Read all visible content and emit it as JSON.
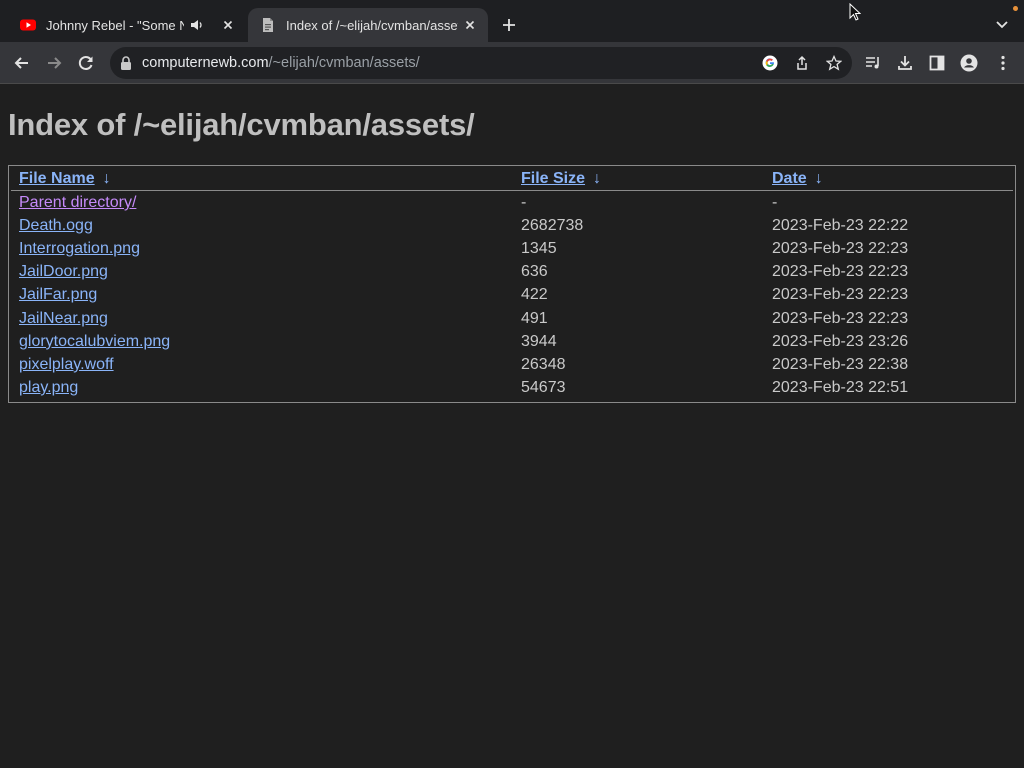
{
  "tabs": [
    {
      "title": "Johnny Rebel - \"Some N*\"",
      "icon": "youtube-icon",
      "audio": true,
      "active": false
    },
    {
      "title": "Index of /~elijah/cvmban/assets/",
      "icon": "document-favicon",
      "audio": false,
      "active": true
    }
  ],
  "address_bar": {
    "host": "computernewb.com",
    "path": "/~elijah/cvmban/assets/"
  },
  "page": {
    "heading": "Index of /~elijah/cvmban/assets/",
    "columns": {
      "name": "File Name",
      "size": "File Size",
      "date": "Date",
      "sort_arrow": "↓"
    },
    "rows": [
      {
        "name": "Parent directory/",
        "size": "-",
        "date": "-"
      },
      {
        "name": "Death.ogg",
        "size": "2682738",
        "date": "2023-Feb-23 22:22"
      },
      {
        "name": "Interrogation.png",
        "size": "1345",
        "date": "2023-Feb-23 22:23"
      },
      {
        "name": "JailDoor.png",
        "size": "636",
        "date": "2023-Feb-23 22:23"
      },
      {
        "name": "JailFar.png",
        "size": "422",
        "date": "2023-Feb-23 22:23"
      },
      {
        "name": "JailNear.png",
        "size": "491",
        "date": "2023-Feb-23 22:23"
      },
      {
        "name": "glorytocalubviem.png",
        "size": "3944",
        "date": "2023-Feb-23 23:26"
      },
      {
        "name": "pixelplay.woff",
        "size": "26348",
        "date": "2023-Feb-23 22:38"
      },
      {
        "name": "play.png",
        "size": "54673",
        "date": "2023-Feb-23 22:51"
      }
    ]
  },
  "colors": {
    "link": "#8ab4f8",
    "visited_link": "#c58af9",
    "page_background": "#1f1f1f",
    "chrome_background": "#35363a"
  }
}
